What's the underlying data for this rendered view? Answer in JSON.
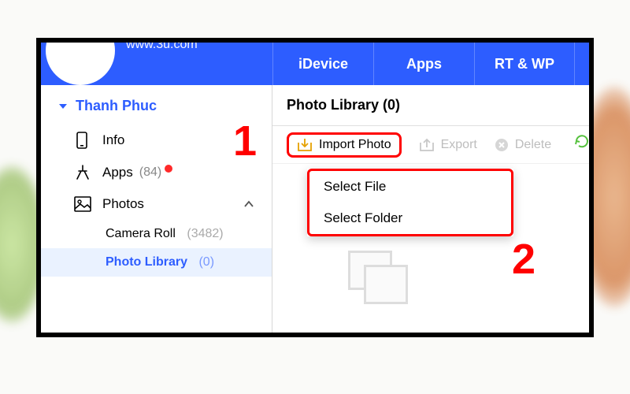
{
  "brand_url": "www.3u.com",
  "top_tabs": {
    "idevice": "iDevice",
    "apps": "Apps",
    "rtwp": "RT & WP"
  },
  "device_name": "Thanh Phuc",
  "sidebar": {
    "info": {
      "label": "Info"
    },
    "apps": {
      "label": "Apps",
      "count": "(84)"
    },
    "photos": {
      "label": "Photos"
    },
    "sub": {
      "camera_roll": {
        "label": "Camera Roll",
        "count": "(3482)"
      },
      "photo_library": {
        "label": "Photo Library",
        "count": "(0)"
      }
    }
  },
  "panel": {
    "title": "Photo Library (0)"
  },
  "toolbar": {
    "import": "Import Photo",
    "export": "Export",
    "delete": "Delete"
  },
  "dropdown": {
    "select_file": "Select File",
    "select_folder": "Select Folder"
  },
  "annotations": {
    "n1": "1",
    "n2": "2"
  }
}
